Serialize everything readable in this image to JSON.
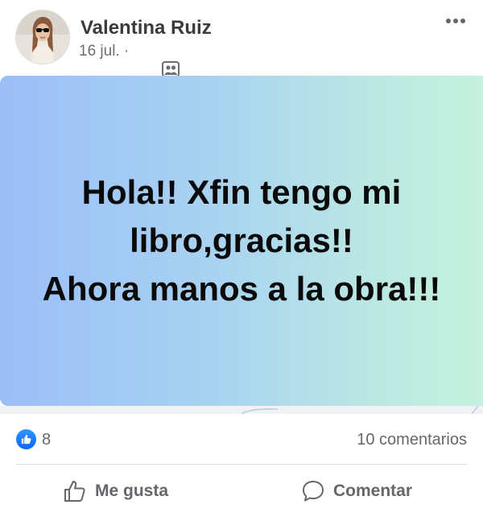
{
  "post": {
    "author": "Valentina Ruiz",
    "date": "16 jul.",
    "separator": " · ",
    "audience_icon": "friends-audience-icon",
    "message_lines": [
      "Hola!! Xfin tengo mi",
      "libro,gracias!!",
      "Ahora manos a la obra!!!"
    ],
    "background_gradient": [
      "#9bbef8",
      "#c4f1dd"
    ]
  },
  "stats": {
    "reaction_icon": "like-reaction-icon",
    "reactions_count": "8",
    "comments": "10 comentarios"
  },
  "actions": {
    "like_label": "Me gusta",
    "comment_label": "Comentar"
  },
  "colors": {
    "like_blue": "#0866ff",
    "muted_text": "#65676b"
  }
}
